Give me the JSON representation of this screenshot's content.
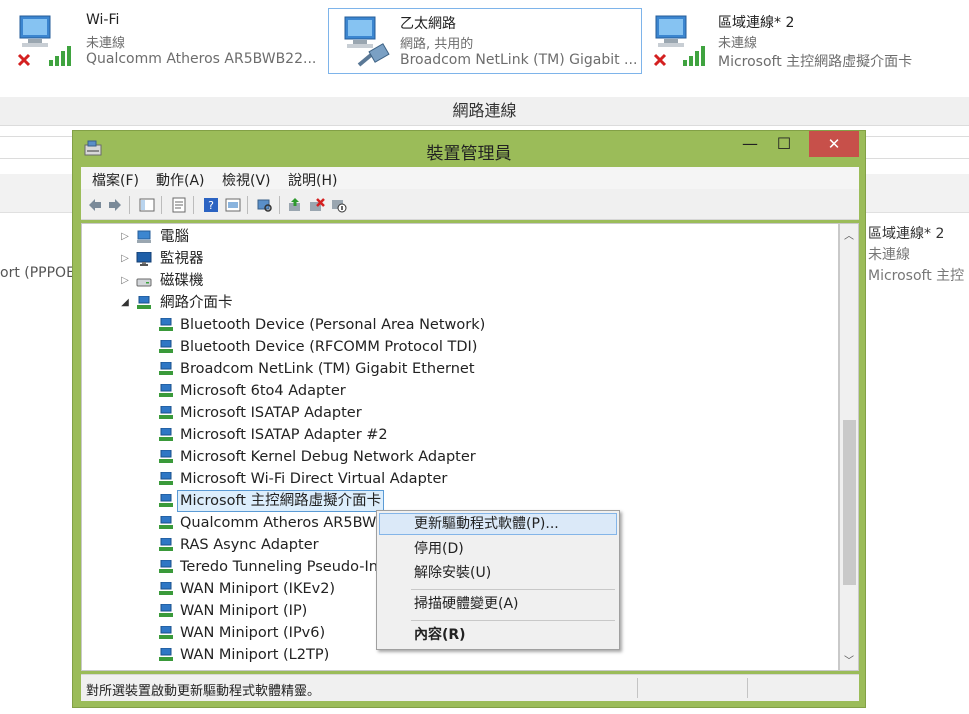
{
  "background": {
    "connections": [
      {
        "name": "Wi-Fi",
        "status": "未連線",
        "device": "Qualcomm Atheros AR5BWB22...",
        "selected": false,
        "error": true
      },
      {
        "name": "乙太網路",
        "status": "網路, 共用的",
        "device": "Broadcom NetLink (TM) Gigabit ...",
        "selected": true,
        "error": false
      },
      {
        "name": "區域連線* 2",
        "status": "未連線",
        "device": "Microsoft 主控網路虛擬介面卡",
        "selected": false,
        "error": true
      }
    ],
    "header_title": "網路連線",
    "left_fragment": "ort (PPPOE",
    "right_card": {
      "name": "區域連線* 2",
      "status": "未連線",
      "device": "Microsoft 主控"
    }
  },
  "window": {
    "title": "裝置管理員",
    "controls": {
      "minimize": "—",
      "maximize": "☐",
      "close": "✕"
    },
    "menu": [
      "檔案(F)",
      "動作(A)",
      "檢視(V)",
      "說明(H)"
    ],
    "tree": {
      "categories": [
        {
          "label": "電腦",
          "expanded": false
        },
        {
          "label": "監視器",
          "expanded": false
        },
        {
          "label": "磁碟機",
          "expanded": false
        },
        {
          "label": "網路介面卡",
          "expanded": true
        }
      ],
      "adapters": [
        "Bluetooth Device (Personal Area Network)",
        "Bluetooth Device (RFCOMM Protocol TDI)",
        "Broadcom NetLink (TM) Gigabit Ethernet",
        "Microsoft 6to4 Adapter",
        "Microsoft ISATAP Adapter",
        "Microsoft ISATAP Adapter #2",
        "Microsoft Kernel Debug Network Adapter",
        "Microsoft Wi-Fi Direct Virtual Adapter",
        "Microsoft 主控網路虛擬介面卡",
        "Qualcomm Atheros AR5BWE",
        "RAS Async Adapter",
        "Teredo Tunneling Pseudo-In",
        "WAN Miniport (IKEv2)",
        "WAN Miniport (IP)",
        "WAN Miniport (IPv6)",
        "WAN Miniport (L2TP)"
      ],
      "selected_index": 8
    },
    "status_text": "對所選裝置啟動更新驅動程式軟體精靈。"
  },
  "context_menu": {
    "items": [
      {
        "label": "更新驅動程式軟體(P)...",
        "highlighted": true,
        "bold": false
      },
      {
        "label": "停用(D)",
        "highlighted": false,
        "bold": false
      },
      {
        "label": "解除安裝(U)",
        "highlighted": false,
        "bold": false
      },
      {
        "label": "掃描硬體變更(A)",
        "highlighted": false,
        "bold": false
      },
      {
        "label": "內容(R)",
        "highlighted": false,
        "bold": true
      }
    ]
  },
  "colors": {
    "window_frame": "#9bbc59",
    "close_button": "#c7504a",
    "selection": "#ddeefc",
    "menu_highlight": "#dbe9f8"
  }
}
